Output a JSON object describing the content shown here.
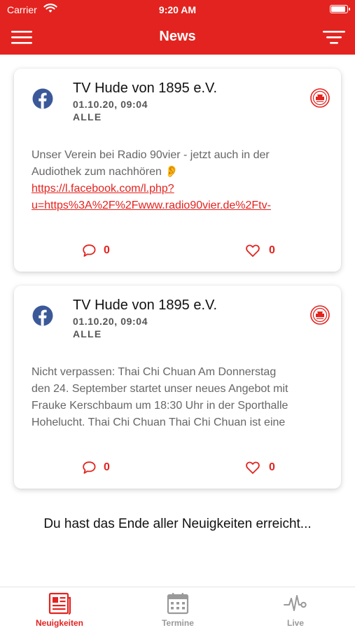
{
  "status_bar": {
    "carrier": "Carrier",
    "time": "9:20 AM"
  },
  "header": {
    "title": "News",
    "menu_icon": "hamburger-menu-icon",
    "filter_icon": "filter-icon"
  },
  "posts": [
    {
      "source_icon": "facebook-icon",
      "author": "TV Hude von 1895 e.V.",
      "date": "01.10.20, 09:04",
      "category": "ALLE",
      "text_lines": [
        "Unser Verein bei Radio 90vier - jetzt auch in der",
        "Audiothek zum nachhören 👂"
      ],
      "link_lines": [
        "https://l.facebook.com/l.php?",
        "u=https%3A%2F%2Fwww.radio90vier.de%2Ftv-"
      ],
      "comments": "0",
      "likes": "0"
    },
    {
      "source_icon": "facebook-icon",
      "author": "TV Hude von 1895 e.V.",
      "date": "01.10.20, 09:04",
      "category": "ALLE",
      "text_lines": [
        "Nicht verpassen: Thai Chi Chuan Am Donnerstag",
        "den 24. September startet unser neues Angebot mit",
        "Frauke Kerschbaum um 18:30 Uhr in der Sporthalle",
        "Hohelucht. Thai Chi Chuan Thai Chi Chuan ist eine"
      ],
      "link_lines": [],
      "comments": "0",
      "likes": "0"
    }
  ],
  "end_message": "Du hast das Ende aller Neuigkeiten erreicht...",
  "tabs": [
    {
      "label": "Neuigkeiten",
      "icon": "newspaper-icon",
      "active": true
    },
    {
      "label": "Termine",
      "icon": "calendar-icon",
      "active": false
    },
    {
      "label": "Live",
      "icon": "pulse-icon",
      "active": false
    }
  ],
  "colors": {
    "brand_red": "#e3231f",
    "facebook_blue": "#3b5998",
    "inactive_gray": "#999999"
  }
}
